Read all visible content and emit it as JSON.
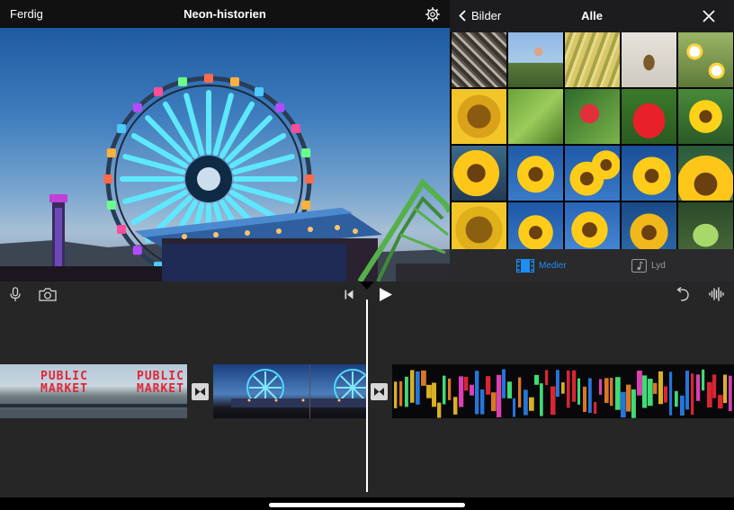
{
  "toolbar": {
    "done_label": "Ferdig",
    "project_title": "Neon-historien",
    "settings_icon": "gear-icon"
  },
  "library": {
    "back_label": "Bilder",
    "filter_label": "Alle",
    "close_icon": "close-icon",
    "tabs": [
      {
        "label": "Medier",
        "icon": "film-icon",
        "selected": true
      },
      {
        "label": "Lyd",
        "icon": "music-note-icon",
        "selected": false
      }
    ],
    "accent_color": "#1e8df5",
    "photos": [
      "seeds",
      "person-holding-sunflower",
      "banana-leaf",
      "seed-on-white",
      "chamomile-flowers",
      "sunflower-center",
      "green-leaf",
      "cherry-on-leaf",
      "strawberry",
      "sunflower-small",
      "sunflower",
      "sunflower-blue-sky",
      "sunflowers-blue-sky",
      "sunflower-blue-sky-2",
      "sunflower-closeup",
      "sunflower-center-2",
      "sunflower-blue-sky-3",
      "sunflower-blue-sky-4",
      "sunflower-blue-sky-5",
      "green-melon"
    ]
  },
  "timeline": {
    "mic_icon": "microphone-icon",
    "camera_icon": "camera-icon",
    "skip_icon": "skip-to-start-icon",
    "play_icon": "play-icon",
    "undo_icon": "undo-icon",
    "audio_icon": "audio-waveform-icon",
    "clips": [
      {
        "name": "public-market-clip",
        "sign_text": [
          "PUBLIC",
          "MARKET"
        ]
      },
      {
        "name": "ferris-wheel-clip"
      },
      {
        "name": "neon-signs-clip"
      }
    ],
    "transitions": 2
  }
}
